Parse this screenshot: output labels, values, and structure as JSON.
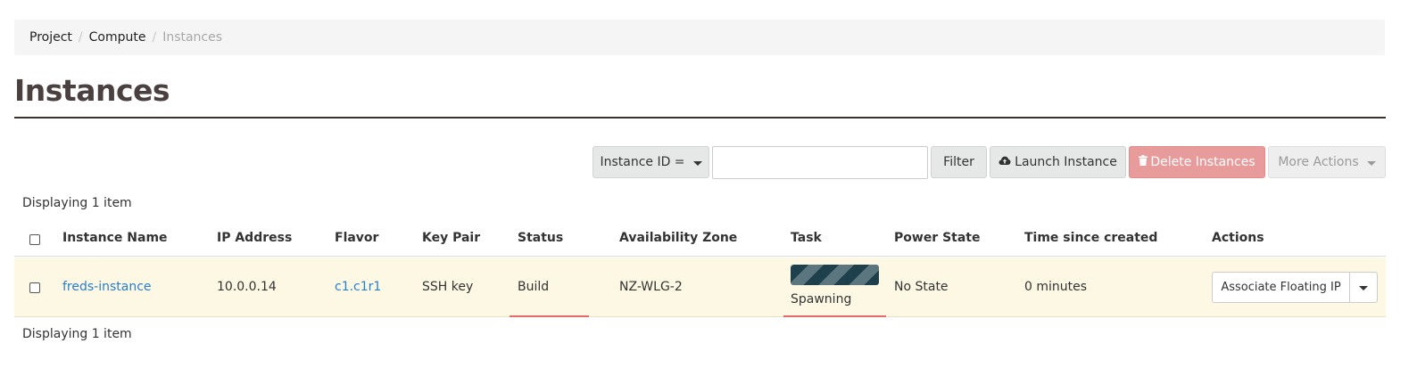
{
  "breadcrumb": {
    "items": [
      "Project",
      "Compute",
      "Instances"
    ],
    "separator": "/"
  },
  "page": {
    "title": "Instances"
  },
  "toolbar": {
    "filter_type_label": "Instance ID =",
    "filter_input_value": "",
    "filter_button": "Filter",
    "launch_button": "Launch Instance",
    "delete_button": "Delete Instances",
    "more_actions_button": "More Actions",
    "launch_icon": "cloud-upload-icon",
    "delete_icon": "trash-icon"
  },
  "table": {
    "count_top": "Displaying 1 item",
    "count_bottom": "Displaying 1 item",
    "columns": [
      "Instance Name",
      "IP Address",
      "Flavor",
      "Key Pair",
      "Status",
      "Availability Zone",
      "Task",
      "Power State",
      "Time since created",
      "Actions"
    ],
    "rows": [
      {
        "name": "freds-instance",
        "ip": "10.0.0.14",
        "flavor": "c1.c1r1",
        "key_pair": "SSH key",
        "status": "Build",
        "zone": "NZ-WLG-2",
        "task": "Spawning",
        "power_state": "No State",
        "time_since_created": "0 minutes",
        "action": "Associate Floating IP"
      }
    ]
  },
  "colors": {
    "link": "#2a7dc9",
    "row_highlight": "#fcf8e3",
    "danger": "#e89b9b",
    "status_underline": "#e56b6b",
    "progress_bar": "#1e3f4c"
  }
}
